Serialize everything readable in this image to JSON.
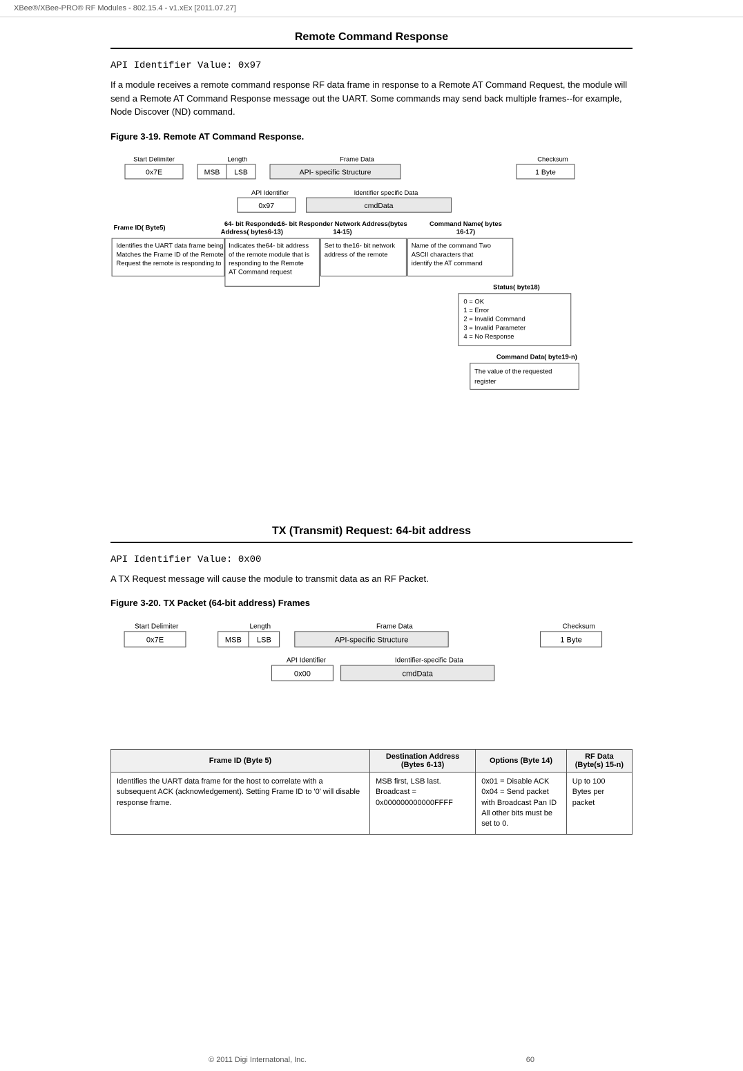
{
  "header": {
    "text": "XBee®/XBee-PRO®  RF Modules - 802.15.4 - v1.xEx [2011.07.27]"
  },
  "footer": {
    "text": "© 2011 Digi Internatonal, Inc.",
    "page": "60"
  },
  "section1": {
    "title": "Remote Command Response",
    "api_value": "API Identifier Value:  0x97",
    "description": "If a module receives a remote command response RF data frame in response to a Remote AT Command Request, the module will send a Remote AT Command Response message out the UART. Some commands may send back multiple frames--for example, Node Discover (ND) command.",
    "figure_label": "Figure 3-19.  Remote AT Command Response.",
    "frame_row": {
      "start_delimiter_label": "Start Delimiter",
      "start_delimiter_val": "0x7E",
      "length_label": "Length",
      "msb_val": "MSB",
      "lsb_val": "LSB",
      "frame_data_label": "Frame Data",
      "api_specific_val": "API-  specific Structure",
      "checksum_label": "Checksum",
      "checksum_val": "1 Byte"
    },
    "second_row": {
      "api_id_label": "API Identifier",
      "api_id_val": "0x97",
      "identifier_label": "Identifier specific Data",
      "cmd_data_val": "cmdData"
    },
    "fields": {
      "frame_id": {
        "label": "Frame ID( Byte5)",
        "desc": "Identifies the UART data frame being reported\nMatches the Frame ID of the Remote Command\nRequest the remote is responding.to"
      },
      "responder_64": {
        "label": "64- bit Responder\nAddress( bytes6-13)",
        "desc": "Indicates the64- bit address\nof the remote module that is\nresponding to the Remote\nAT Command request"
      },
      "responder_16": {
        "label": "16- bit Responder Network Address(bytes\n14-15)",
        "desc": "Set to the16- bit network\naddress of the remote"
      },
      "cmd_name": {
        "label": "Command Name( bytes\n16-17)",
        "desc": "Name of the command  Two\nASCII characters that\nidentify the AT command"
      },
      "status": {
        "label": "Status( byte18)",
        "values": [
          "0 = OK",
          "1 = Error",
          "2 =  Invalid Command",
          "3 =  Invalid Parameter",
          "4 =   No Response"
        ]
      },
      "cmd_data": {
        "label": "Command Data( byte19-n)",
        "desc": "The value of the requested\nregister"
      }
    }
  },
  "section2": {
    "title": "TX (Transmit) Request: 64-bit address",
    "api_value1": "API Identifier Value:  0x00",
    "api_value2": "A TX Request message will cause the module to transmit data as an RF Packet.",
    "figure_label": "Figure 3-20.  TX Packet (64-bit address) Frames",
    "frame_row": {
      "start_delimiter_label": "Start Delimiter",
      "start_delimiter_val": "0x7E",
      "length_label": "Length",
      "msb_val": "MSB",
      "lsb_val": "LSB",
      "frame_data_label": "Frame Data",
      "api_specific_val": "API-specific Structure",
      "checksum_label": "Checksum",
      "checksum_val": "1 Byte"
    },
    "second_row": {
      "api_id_label": "API Identifier",
      "api_id_val": "0x00",
      "identifier_label": "Identifier-specific Data",
      "cmd_data_val": "cmdData"
    },
    "table": {
      "headers": [
        "Frame ID (Byte 5)",
        "Destination Address (Bytes 6-13)",
        "Options (Byte 14)",
        "RF Data (Byte(s) 15-n)"
      ],
      "rows": [
        [
          "Identifies the UART data frame for the host to correlate with a subsequent ACK (acknowledgement). Setting Frame ID to '0' will disable response frame.",
          "MSB first, LSB last.\nBroadcast =\n0x000000000000FFFF",
          "0x01 = Disable ACK\n0x04 = Send packet with Broadcast Pan ID\nAll other bits must be set to 0.",
          "Up to 100 Bytes per packet"
        ]
      ]
    }
  }
}
